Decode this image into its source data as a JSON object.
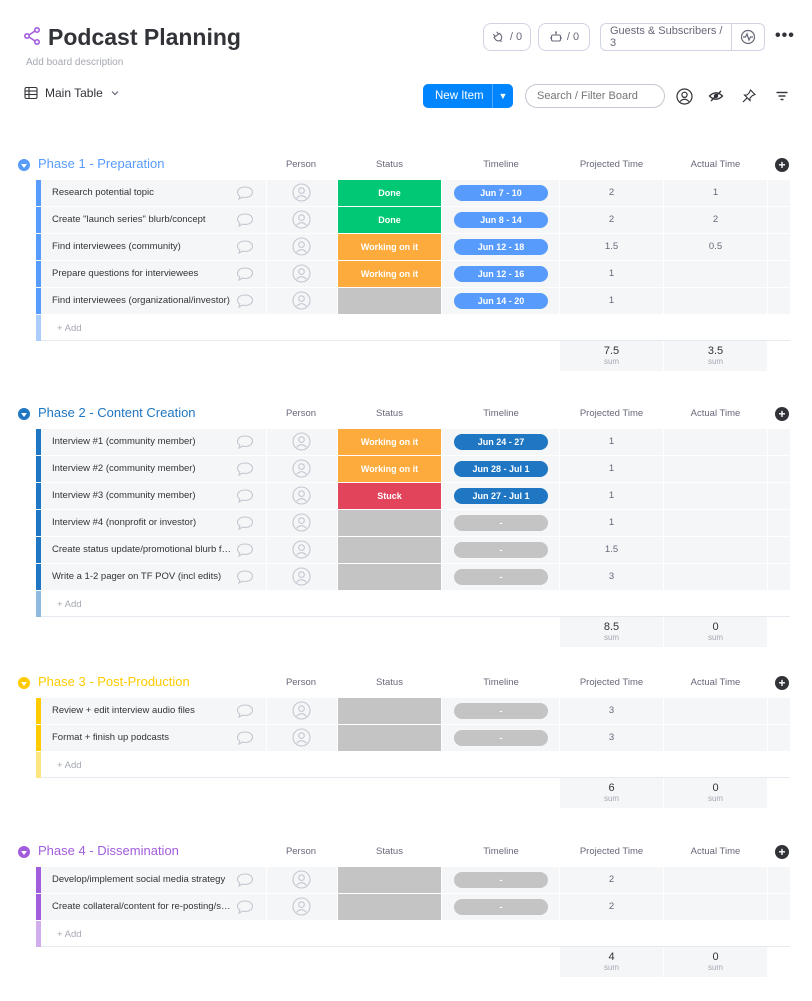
{
  "board": {
    "title": "Podcast Planning",
    "description": "Add board description",
    "integrations_count": "/ 0",
    "automations_count": "/ 0",
    "guests_label": "Guests & Subscribers / 3",
    "more": "•••"
  },
  "toolbar": {
    "view_label": "Main Table",
    "new_item_label": "New Item",
    "search_placeholder": "Search / Filter Board"
  },
  "columns": {
    "person": "Person",
    "status": "Status",
    "timeline": "Timeline",
    "projected": "Projected Time",
    "actual": "Actual Time"
  },
  "add_item_label": "+ Add",
  "sum_label": "sum",
  "colors": {
    "primary": "#0085ff",
    "done": "#00c875",
    "working": "#fdab3d",
    "stuck": "#e2445c",
    "empty_status": "#c4c4c4",
    "timeline_blue": "#579bfc",
    "timeline_dark": "#1f76c2",
    "phase1": "#579bfc",
    "phase2": "#1f76c2",
    "phase3": "#ffcb00",
    "phase4": "#a25ddc"
  },
  "groups": [
    {
      "title": "Phase 1 - Preparation",
      "color": "#579bfc",
      "title_color": "#579bfc",
      "items": [
        {
          "name": "Research potential topic",
          "status": "Done",
          "status_color": "#00c875",
          "timeline": "Jun 7 - 10",
          "timeline_color": "#579bfc",
          "projected": "2",
          "actual": "1"
        },
        {
          "name": "Create \"launch series\" blurb/concept",
          "status": "Done",
          "status_color": "#00c875",
          "timeline": "Jun 8 - 14",
          "timeline_color": "#579bfc",
          "projected": "2",
          "actual": "2"
        },
        {
          "name": "Find interviewees (community)",
          "status": "Working on it",
          "status_color": "#fdab3d",
          "timeline": "Jun 12 - 18",
          "timeline_color": "#579bfc",
          "projected": "1.5",
          "actual": "0.5"
        },
        {
          "name": "Prepare questions for interviewees",
          "status": "Working on it",
          "status_color": "#fdab3d",
          "timeline": "Jun 12 - 16",
          "timeline_color": "#579bfc",
          "projected": "1",
          "actual": ""
        },
        {
          "name": "Find interviewees (organizational/investor)",
          "status": "",
          "status_color": "#c4c4c4",
          "timeline": "Jun 14 - 20",
          "timeline_color": "#579bfc",
          "projected": "1",
          "actual": ""
        }
      ],
      "sum_projected": "7.5",
      "sum_actual": "3.5"
    },
    {
      "title": "Phase 2 - Content Creation",
      "color": "#1f76c2",
      "title_color": "#1f76c2",
      "items": [
        {
          "name": "Interview #1 (community member)",
          "status": "Working on it",
          "status_color": "#fdab3d",
          "timeline": "Jun 24 - 27",
          "timeline_color": "#1f76c2",
          "projected": "1",
          "actual": ""
        },
        {
          "name": "Interview #2 (community member)",
          "status": "Working on it",
          "status_color": "#fdab3d",
          "timeline": "Jun 28 - Jul 1",
          "timeline_color": "#1f76c2",
          "projected": "1",
          "actual": ""
        },
        {
          "name": "Interview #3 (community member)",
          "status": "Stuck",
          "status_color": "#e2445c",
          "timeline": "Jun 27 - Jul 1",
          "timeline_color": "#1f76c2",
          "projected": "1",
          "actual": ""
        },
        {
          "name": "Interview #4 (nonprofit or investor)",
          "status": "",
          "status_color": "#c4c4c4",
          "timeline": "-",
          "timeline_color": "#c4c4c4",
          "projected": "1",
          "actual": ""
        },
        {
          "name": "Create status update/promotional blurb for series",
          "status": "",
          "status_color": "#c4c4c4",
          "timeline": "-",
          "timeline_color": "#c4c4c4",
          "projected": "1.5",
          "actual": ""
        },
        {
          "name": "Write a 1-2 pager on TF POV (incl edits)",
          "status": "",
          "status_color": "#c4c4c4",
          "timeline": "-",
          "timeline_color": "#c4c4c4",
          "projected": "3",
          "actual": ""
        }
      ],
      "sum_projected": "8.5",
      "sum_actual": "0"
    },
    {
      "title": "Phase 3 - Post-Production",
      "color": "#ffcb00",
      "title_color": "#ffcb00",
      "items": [
        {
          "name": "Review + edit interview audio files",
          "status": "",
          "status_color": "#c4c4c4",
          "timeline": "-",
          "timeline_color": "#c4c4c4",
          "projected": "3",
          "actual": ""
        },
        {
          "name": "Format + finish up podcasts",
          "status": "",
          "status_color": "#c4c4c4",
          "timeline": "-",
          "timeline_color": "#c4c4c4",
          "projected": "3",
          "actual": ""
        }
      ],
      "sum_projected": "6",
      "sum_actual": "0"
    },
    {
      "title": "Phase 4 - Dissemination",
      "color": "#a25ddc",
      "title_color": "#a25ddc",
      "items": [
        {
          "name": "Develop/implement social media strategy",
          "status": "",
          "status_color": "#c4c4c4",
          "timeline": "-",
          "timeline_color": "#c4c4c4",
          "projected": "2",
          "actual": ""
        },
        {
          "name": "Create collateral/content for re-posting/sharing",
          "status": "",
          "status_color": "#c4c4c4",
          "timeline": "-",
          "timeline_color": "#c4c4c4",
          "projected": "2",
          "actual": ""
        }
      ],
      "sum_projected": "4",
      "sum_actual": "0"
    }
  ]
}
